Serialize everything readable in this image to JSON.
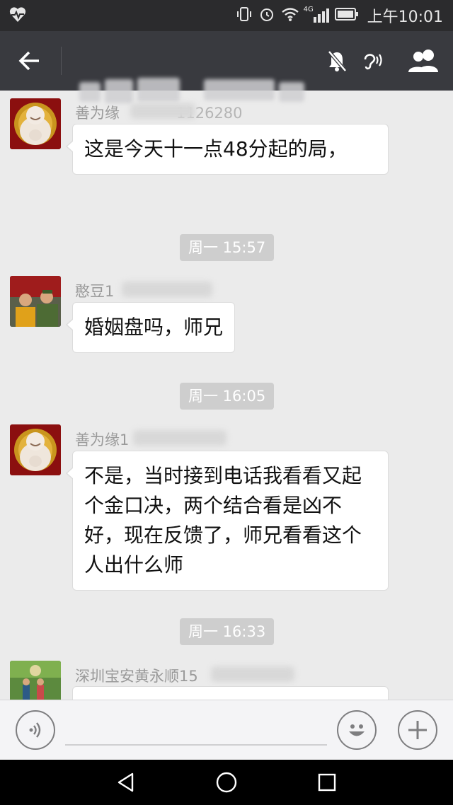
{
  "status_bar": {
    "time": "上午10:01",
    "network": "4G",
    "icons": [
      "heart-pulse-icon",
      "vibrate-icon",
      "alarm-icon",
      "wifi-icon",
      "signal-icon",
      "battery-icon"
    ]
  },
  "title_bar": {
    "title": "",
    "icons": [
      "back-arrow-icon",
      "mute-bell-icon",
      "earpiece-icon",
      "group-members-icon"
    ]
  },
  "messages": [
    {
      "sender": "善为缘",
      "sender_suffix": "1126280",
      "text": "这是今天十一点48分起的局，",
      "avatar": "buddha-avatar"
    },
    {
      "timestamp": "周一 15:57"
    },
    {
      "sender": "憨豆1",
      "sender_suffix": "",
      "text": "婚姻盘吗，师兄",
      "avatar": "soldiers-avatar"
    },
    {
      "timestamp": "周一 16:05"
    },
    {
      "sender": "善为缘1",
      "sender_suffix": "",
      "text": "不是，当时接到电话我看看又起个金口决，两个结合看是凶不好，现在反馈了，师兄看看这个人出什么师",
      "avatar": "buddha-avatar"
    },
    {
      "timestamp": "周一 16:33"
    },
    {
      "sender": "深圳宝安黄永顺15",
      "sender_suffix": "",
      "text": "",
      "avatar": "outdoor-avatar"
    }
  ],
  "input_bar": {
    "placeholder": "",
    "icons": [
      "voice-icon",
      "emoji-icon",
      "plus-icon"
    ]
  },
  "colors": {
    "status_bg": "#2b2b2d",
    "title_bg": "#393a3f",
    "chat_bg": "#ebebeb",
    "bubble_bg": "#ffffff",
    "timestamp_bg": "#cecece"
  }
}
